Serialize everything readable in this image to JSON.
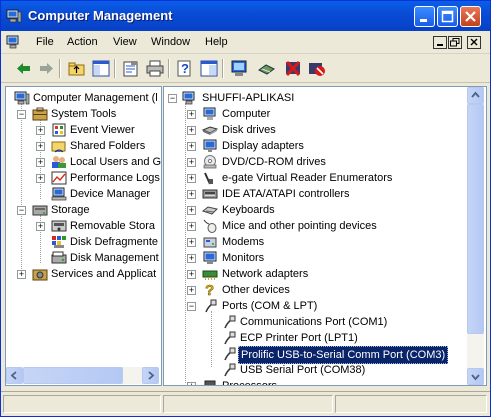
{
  "window": {
    "title": "Computer Management"
  },
  "menu": [
    "File",
    "Action",
    "View",
    "Window",
    "Help"
  ],
  "toolbar": [
    "back-icon",
    "forward-icon",
    "up-folder-icon",
    "show-hide-tree-icon",
    "properties-icon",
    "print-icon",
    "help-icon",
    "console-icon",
    "scan-hardware-icon",
    "update-driver-icon",
    "uninstall-icon",
    "disable-icon"
  ],
  "left_tree": [
    {
      "label": "Computer Management (l",
      "icon": "computer-icon"
    },
    {
      "label": "System Tools",
      "icon": "tools-icon"
    },
    {
      "label": "Event Viewer",
      "icon": "event-viewer-icon"
    },
    {
      "label": "Shared Folders",
      "icon": "shared-folder-icon"
    },
    {
      "label": "Local Users and G",
      "icon": "users-icon"
    },
    {
      "label": "Performance Logs",
      "icon": "performance-icon"
    },
    {
      "label": "Device Manager",
      "icon": "device-manager-icon"
    },
    {
      "label": "Storage",
      "icon": "storage-icon"
    },
    {
      "label": "Removable Stora",
      "icon": "removable-storage-icon"
    },
    {
      "label": "Disk Defragmente",
      "icon": "defrag-icon"
    },
    {
      "label": "Disk Management",
      "icon": "disk-management-icon"
    },
    {
      "label": "Services and Applicat",
      "icon": "services-icon"
    }
  ],
  "right_tree": [
    {
      "label": "SHUFFI-APLIKASI",
      "icon": "computer-icon"
    },
    {
      "label": "Computer",
      "icon": "computer-icon"
    },
    {
      "label": "Disk drives",
      "icon": "disk-drive-icon"
    },
    {
      "label": "Display adapters",
      "icon": "display-icon"
    },
    {
      "label": "DVD/CD-ROM drives",
      "icon": "cdrom-icon"
    },
    {
      "label": "e-gate Virtual Reader Enumerators",
      "icon": "reader-icon"
    },
    {
      "label": "IDE ATA/ATAPI controllers",
      "icon": "ide-icon"
    },
    {
      "label": "Keyboards",
      "icon": "keyboard-icon"
    },
    {
      "label": "Mice and other pointing devices",
      "icon": "mouse-icon"
    },
    {
      "label": "Modems",
      "icon": "modem-icon"
    },
    {
      "label": "Monitors",
      "icon": "monitor-icon"
    },
    {
      "label": "Network adapters",
      "icon": "network-icon"
    },
    {
      "label": "Other devices",
      "icon": "other-devices-icon"
    },
    {
      "label": "Ports (COM & LPT)",
      "icon": "port-icon"
    },
    {
      "label": "Communications Port (COM1)",
      "icon": "port-icon"
    },
    {
      "label": "ECP Printer Port (LPT1)",
      "icon": "port-icon"
    },
    {
      "label": "Prolific USB-to-Serial Comm Port (COM3)",
      "icon": "port-icon"
    },
    {
      "label": "USB Serial Port (COM38)",
      "icon": "port-icon"
    },
    {
      "label": "Processors",
      "icon": "processor-icon"
    }
  ],
  "colors": {
    "titlebar": "#0a4cd6",
    "selection": "#0a246a",
    "face": "#ece9d8"
  }
}
